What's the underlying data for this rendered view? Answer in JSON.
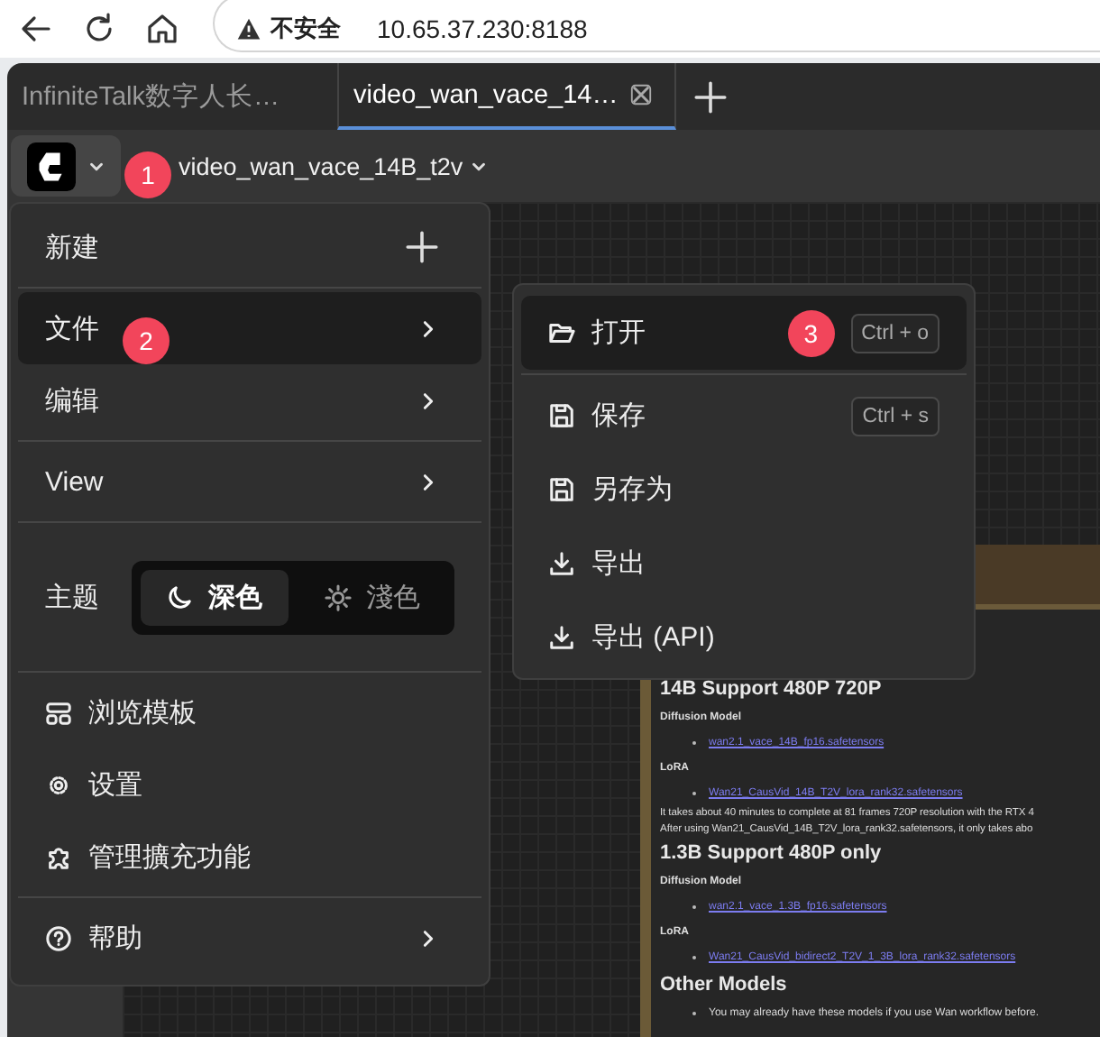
{
  "browser": {
    "security_label": "不安全",
    "url": "10.65.37.230:8188"
  },
  "tabs": [
    {
      "label": "InfiniteTalk数字人长…",
      "selected": false
    },
    {
      "label": "video_wan_vace_14…",
      "selected": true
    }
  ],
  "topbar": {
    "logo_badge": "1",
    "workflow_name": "video_wan_vace_14B_t2v"
  },
  "main_menu": {
    "sections": [
      [
        {
          "kind": "create",
          "label": "新建",
          "selected": false
        }
      ],
      [
        {
          "kind": "submenu",
          "label": "文件",
          "selected": true,
          "badge": "2"
        },
        {
          "kind": "submenu",
          "label": "编辑",
          "selected": false
        }
      ],
      [
        {
          "kind": "submenu",
          "label": "View",
          "selected": false
        }
      ],
      [
        {
          "kind": "theme",
          "label": "主题",
          "options": [
            {
              "label": "深色",
              "selected": true
            },
            {
              "label": "淺色",
              "selected": false
            }
          ]
        }
      ],
      [
        {
          "kind": "command",
          "label": "浏览模板",
          "selected": false
        },
        {
          "kind": "command",
          "label": "设置",
          "selected": false
        },
        {
          "kind": "command",
          "label": "管理擴充功能",
          "selected": false
        }
      ],
      [
        {
          "kind": "submenu",
          "label": "帮助",
          "selected": false
        }
      ]
    ]
  },
  "file_menu": {
    "sections": [
      [
        {
          "label": "打开",
          "shortcut": "Ctrl + o",
          "selected": true,
          "badge": "3"
        }
      ],
      [
        {
          "label": "保存",
          "shortcut": "Ctrl + s",
          "selected": false
        },
        {
          "label": "另存为",
          "selected": false
        },
        {
          "label": "导出",
          "selected": false
        },
        {
          "label": "导出 (API)",
          "selected": false
        }
      ]
    ]
  },
  "note_node": {
    "content": [
      {
        "kind": "heading",
        "text": "14B Support 480P 720P"
      },
      {
        "kind": "label",
        "text": "Diffusion Model"
      },
      {
        "kind": "link",
        "text": "wan2.1_vace_14B_fp16.safetensors"
      },
      {
        "kind": "label",
        "text": "LoRA"
      },
      {
        "kind": "link",
        "text": "Wan21_CausVid_14B_T2V_lora_rank32.safetensors"
      },
      {
        "kind": "text",
        "text": "It takes about 40 minutes to complete at 81 frames 720P resolution with the RTX 4"
      },
      {
        "kind": "text",
        "text": "After using Wan21_CausVid_14B_T2V_lora_rank32.safetensors, it only takes abo"
      },
      {
        "kind": "heading",
        "text": "1.3B Support 480P only"
      },
      {
        "kind": "label",
        "text": "Diffusion Model"
      },
      {
        "kind": "link",
        "text": "wan2.1_vace_1.3B_fp16.safetensors"
      },
      {
        "kind": "label",
        "text": "LoRA"
      },
      {
        "kind": "link",
        "text": "Wan21_CausVid_bidirect2_T2V_1_3B_lora_rank32.safetensors"
      },
      {
        "kind": "heading",
        "text": "Other Models"
      },
      {
        "kind": "bullet",
        "text": "You may already have these models if you use Wan workflow before."
      }
    ]
  }
}
